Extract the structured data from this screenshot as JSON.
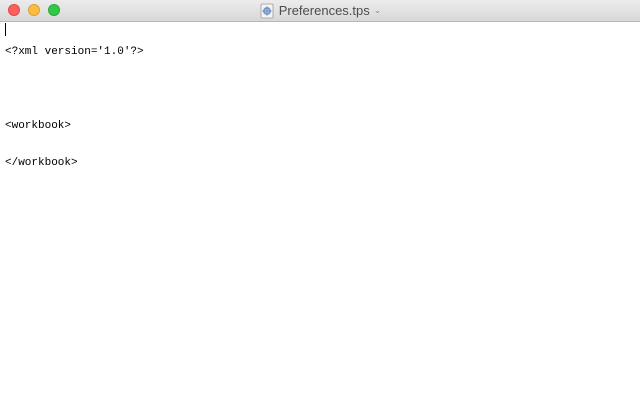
{
  "window": {
    "title": "Preferences.tps",
    "title_icon": "document-icon",
    "menu_chevron": "⌄"
  },
  "editor": {
    "lines": [
      "<?xml version='1.0'?>",
      "",
      "<workbook>",
      "</workbook>"
    ]
  },
  "colors": {
    "close": "#fc605c",
    "minimize": "#fdbc40",
    "zoom": "#34c84a"
  }
}
